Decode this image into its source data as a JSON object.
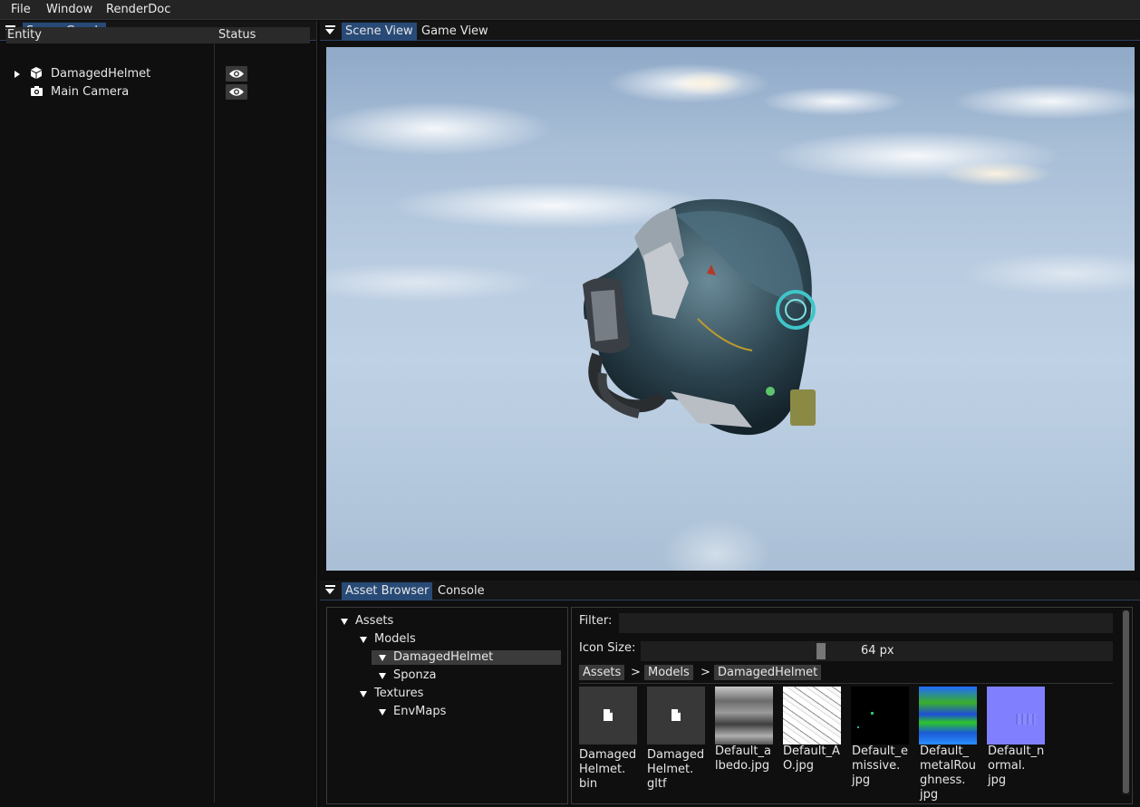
{
  "menu": {
    "file": "File",
    "window": "Window",
    "renderdoc": "RenderDoc"
  },
  "scene_graph": {
    "tab": "Scene Graph",
    "columns": {
      "entity": "Entity",
      "status": "Status"
    },
    "entities": [
      {
        "label": "DamagedHelmet",
        "icon": "cube-icon",
        "expandable": true,
        "visible": true
      },
      {
        "label": "Main Camera",
        "icon": "camera-icon",
        "expandable": false,
        "visible": true
      }
    ]
  },
  "viewport_tabs": {
    "scene_view": "Scene View",
    "game_view": "Game View",
    "active": "Scene View"
  },
  "bottom_tabs": {
    "asset_browser": "Asset Browser",
    "console": "Console",
    "active": "Asset Browser"
  },
  "asset_tree": {
    "assets": "Assets",
    "models": "Models",
    "damaged_helmet": "DamagedHelmet",
    "sponza": "Sponza",
    "textures": "Textures",
    "envmaps": "EnvMaps",
    "selected": "DamagedHelmet"
  },
  "asset_panel": {
    "filter_label": "Filter:",
    "filter_value": "",
    "icon_size_label": "Icon Size:",
    "icon_size_value": "64 px",
    "icon_size_fraction": 0.38,
    "breadcrumb": [
      "Assets",
      "Models",
      "DamagedHelmet"
    ],
    "breadcrumb_sep": ">",
    "files": [
      {
        "label": "Damaged\nHelmet.\nbin",
        "kind": "file-icon"
      },
      {
        "label": "Damaged\nHelmet.\ngltf",
        "kind": "file-icon"
      },
      {
        "label": "Default_a\nlbedo.jpg",
        "kind": "albedo-thumbnail"
      },
      {
        "label": "Default_A\nO.jpg",
        "kind": "ao-thumbnail"
      },
      {
        "label": "Default_e\nmissive.\njpg",
        "kind": "emissive-thumbnail"
      },
      {
        "label": "Default_\nmetalRou\nghness.\njpg",
        "kind": "metal-roughness-thumbnail"
      },
      {
        "label": "Default_n\normal.\njpg",
        "kind": "normal-thumbnail"
      }
    ]
  },
  "colors": {
    "accent_tab": "#284a76",
    "panel_bg": "#0f0f0f"
  }
}
